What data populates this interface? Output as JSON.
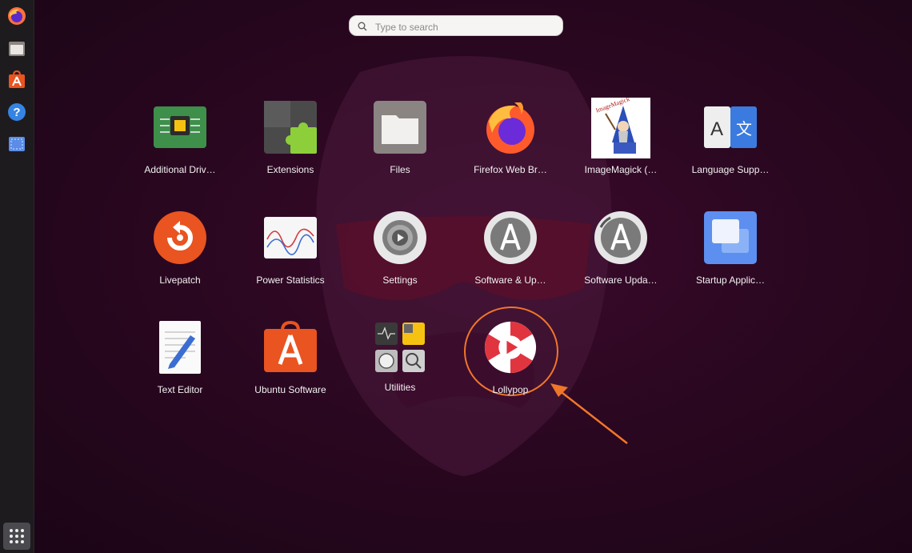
{
  "search": {
    "placeholder": "Type to search"
  },
  "dock": {
    "items": [
      {
        "name": "firefox-icon"
      },
      {
        "name": "files-icon"
      },
      {
        "name": "ubuntu-software-icon"
      },
      {
        "name": "help-icon"
      },
      {
        "name": "screenshot-icon"
      }
    ],
    "show_apps": "show-applications-icon"
  },
  "apps": [
    {
      "label": "Additional Driv…",
      "icon": "chip-icon"
    },
    {
      "label": "Extensions",
      "icon": "puzzle-icon"
    },
    {
      "label": "Files",
      "icon": "folder-icon"
    },
    {
      "label": "Firefox Web Br…",
      "icon": "firefox-icon"
    },
    {
      "label": "ImageMagick (…",
      "icon": "wizard-icon",
      "icon_text": "ImageMagick"
    },
    {
      "label": "Language Supp…",
      "icon": "translate-icon",
      "icon_text_a": "A",
      "icon_text_b": "文"
    },
    {
      "label": "Livepatch",
      "icon": "livepatch-icon"
    },
    {
      "label": "Power Statistics",
      "icon": "graph-icon"
    },
    {
      "label": "Settings",
      "icon": "gear-icon"
    },
    {
      "label": "Software & Up…",
      "icon": "software-updates-icon"
    },
    {
      "label": "Software Upda…",
      "icon": "software-updater-icon"
    },
    {
      "label": "Startup Applic…",
      "icon": "startup-icon"
    },
    {
      "label": "Text Editor",
      "icon": "text-editor-icon"
    },
    {
      "label": "Ubuntu Software",
      "icon": "shopping-bag-icon"
    },
    {
      "label": "Utilities",
      "icon": "folder-grid-icon"
    },
    {
      "label": "Lollypop",
      "icon": "lollypop-icon"
    }
  ],
  "colors": {
    "accent": "#f0762a",
    "ubuntu_orange": "#e95420",
    "background": "#2a0720"
  }
}
